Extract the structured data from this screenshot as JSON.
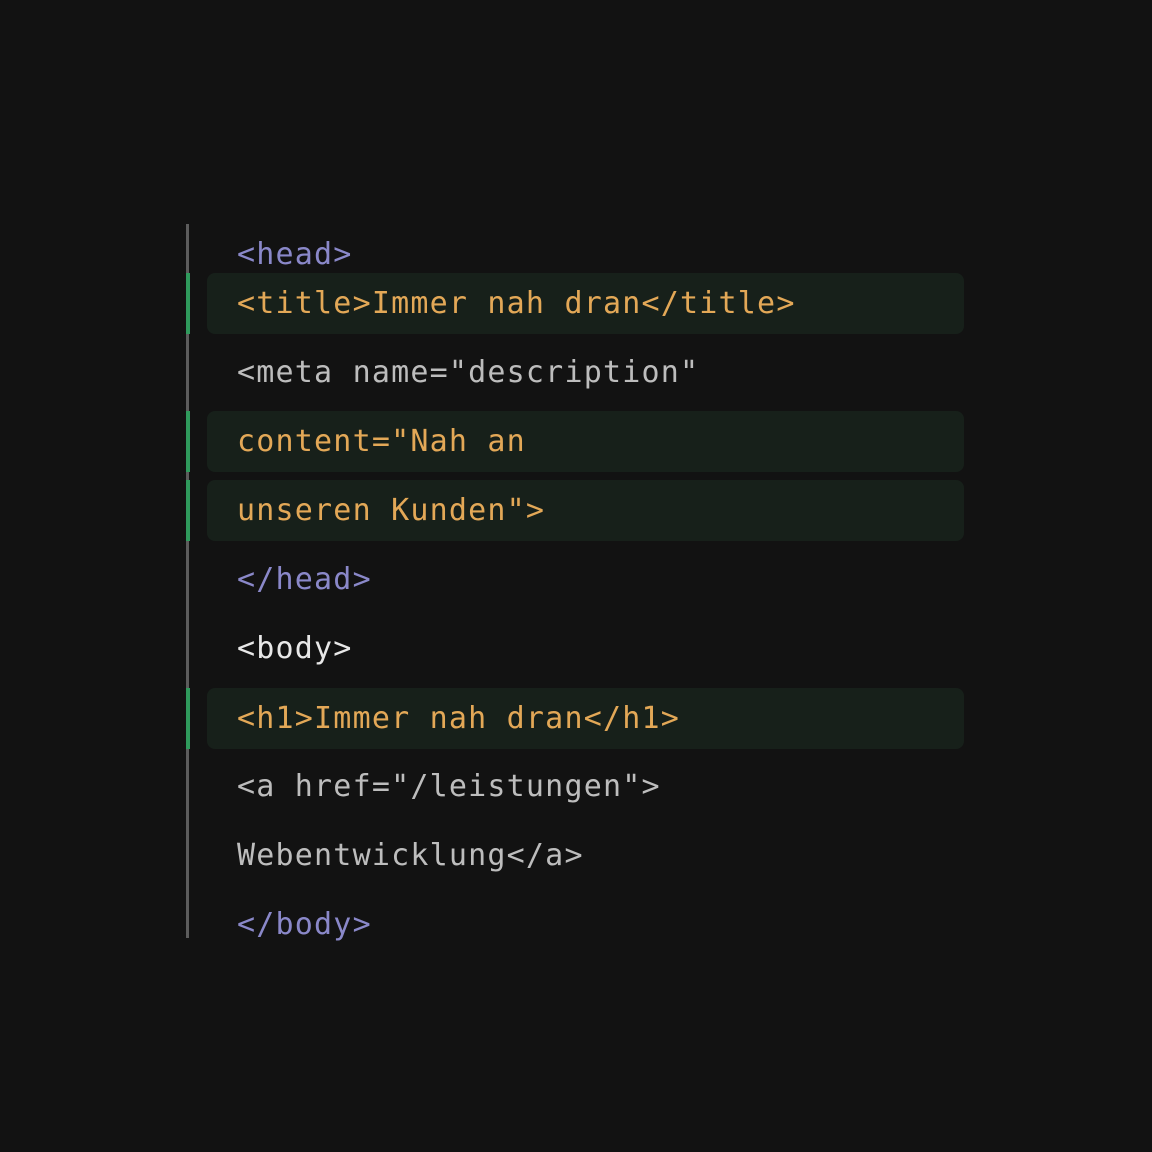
{
  "colors": {
    "background": "#121212",
    "gutter_rail": "#5c5c5c",
    "highlight_background": "#17201a",
    "highlight_marker": "#2f9a5c",
    "tag_purple": "#8a88c9",
    "highlight_orange": "#e3a857",
    "plain_gray": "#bdbdbd",
    "plain_white": "#e8e8e8"
  },
  "lines": [
    {
      "text": "<head>",
      "color": "#8a88c9",
      "highlighted": false
    },
    {
      "text": "<title>Immer nah dran</title>",
      "color": "#e3a857",
      "highlighted": true
    },
    {
      "text": "<meta name=\"description\"",
      "color": "#bdbdbd",
      "highlighted": false
    },
    {
      "text": "content=\"Nah an",
      "color": "#e3a857",
      "highlighted": true
    },
    {
      "text": "unseren Kunden\">",
      "color": "#e3a857",
      "highlighted": true
    },
    {
      "text": "</head>",
      "color": "#8a88c9",
      "highlighted": false
    },
    {
      "text": "<body>",
      "color": "#e8e8e8",
      "highlighted": false
    },
    {
      "text": "<h1>Immer nah dran</h1>",
      "color": "#e3a857",
      "highlighted": true
    },
    {
      "text": "<a href=\"/leistungen\">",
      "color": "#bdbdbd",
      "highlighted": false
    },
    {
      "text": "Webentwicklung</a>",
      "color": "#bdbdbd",
      "highlighted": false
    },
    {
      "text": "</body>",
      "color": "#8a88c9",
      "highlighted": false
    }
  ]
}
